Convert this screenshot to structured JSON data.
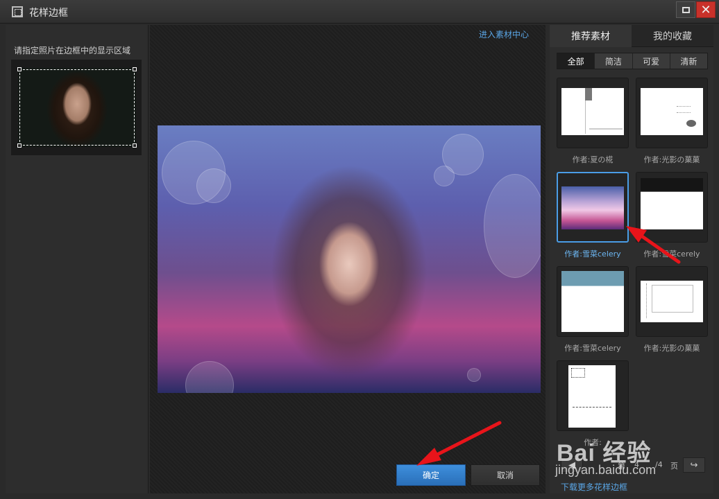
{
  "window": {
    "title": "花样边框"
  },
  "left": {
    "label": "请指定照片在边框中的显示区域"
  },
  "center": {
    "enter_link": "进入素材中心",
    "ok_label": "确定",
    "cancel_label": "取消"
  },
  "right": {
    "tabs": [
      {
        "label": "推荐素材",
        "active": true
      },
      {
        "label": "我的收藏",
        "active": false
      }
    ],
    "filters": [
      {
        "label": "全部",
        "active": true
      },
      {
        "label": "简洁",
        "active": false
      },
      {
        "label": "可爱",
        "active": false
      },
      {
        "label": "清新",
        "active": false
      }
    ],
    "cards": [
      {
        "caption": "作者:夏の椛",
        "selected": false
      },
      {
        "caption": "作者:光影の菓菓",
        "selected": false
      },
      {
        "caption": "作者:雪菜celery",
        "selected": true
      },
      {
        "caption": "作者:雪菜cerely",
        "selected": false
      },
      {
        "caption": "作者:雪菜celery",
        "selected": false
      },
      {
        "caption": "作者:光影の菓菓",
        "selected": false
      },
      {
        "caption": "作者:",
        "selected": false
      }
    ],
    "pager": {
      "prefix": "第",
      "current": "4",
      "total": "/4",
      "suffix": "页"
    },
    "more_link": "下载更多花样边框"
  },
  "watermark": {
    "brand": "Bai 经验",
    "url": "jingyan.baidu.com"
  },
  "colors": {
    "accent": "#4a9de6",
    "annotation": "#e8141a"
  }
}
